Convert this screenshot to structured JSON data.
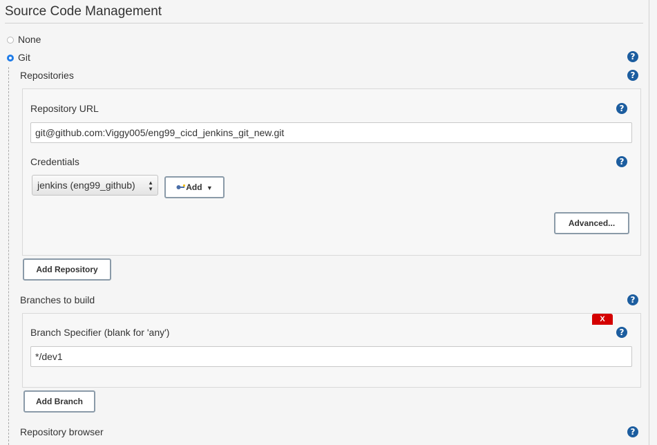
{
  "section": {
    "title": "Source Code Management"
  },
  "scm_options": {
    "none_label": "None",
    "git_label": "Git",
    "selected": "Git"
  },
  "repositories": {
    "label": "Repositories",
    "url_label": "Repository URL",
    "url_value": "git@github.com:Viggy005/eng99_cicd_jenkins_git_new.git",
    "credentials_label": "Credentials",
    "credentials_value": "jenkins (eng99_github)",
    "add_label": "Add",
    "advanced_label": "Advanced...",
    "add_repository_label": "Add Repository"
  },
  "branches": {
    "label": "Branches to build",
    "delete_label": "X",
    "specifier_label": "Branch Specifier (blank for 'any')",
    "specifier_value": "*/dev1",
    "add_branch_label": "Add Branch"
  },
  "repository_browser": {
    "label": "Repository browser"
  },
  "help": {
    "symbol": "?"
  },
  "colors": {
    "accent": "#1f7ce8",
    "help": "#1c5d9f",
    "danger": "#d40000"
  }
}
